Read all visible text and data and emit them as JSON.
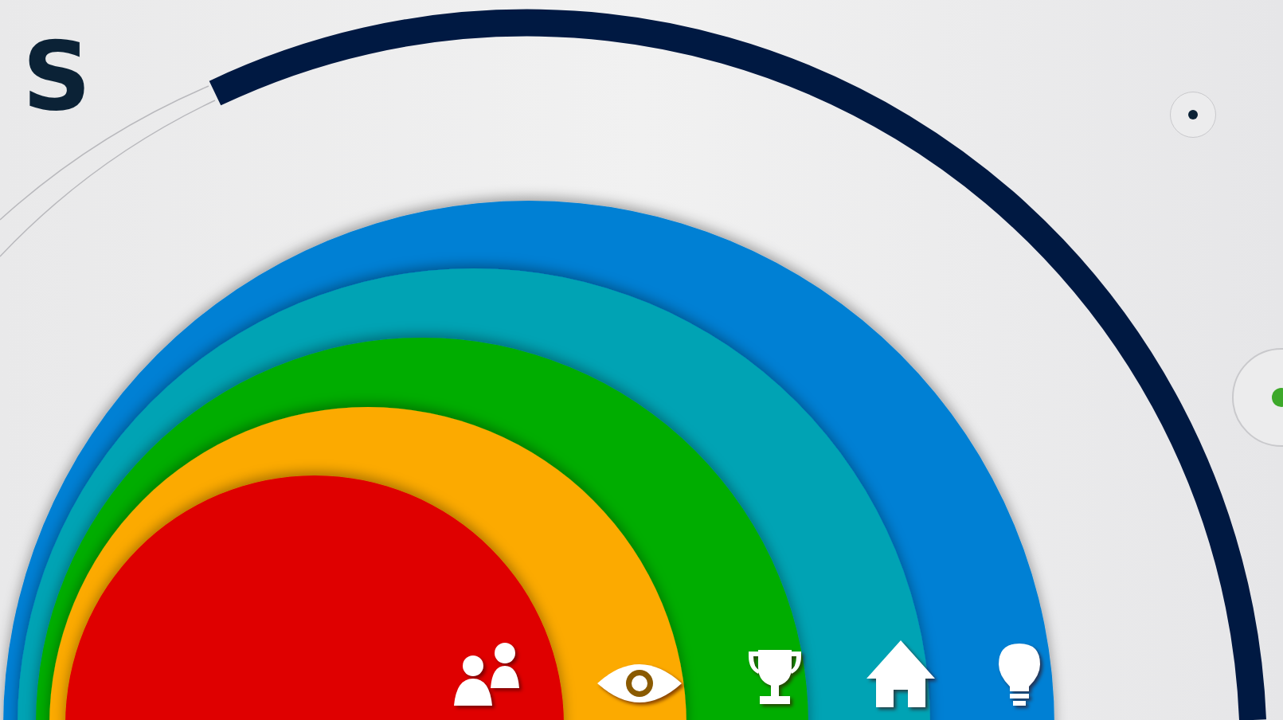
{
  "heading": "S",
  "nav": [
    {
      "kind": "people"
    },
    {
      "kind": "eye"
    },
    {
      "kind": "trophy"
    },
    {
      "kind": "house"
    },
    {
      "kind": "bulb"
    }
  ]
}
